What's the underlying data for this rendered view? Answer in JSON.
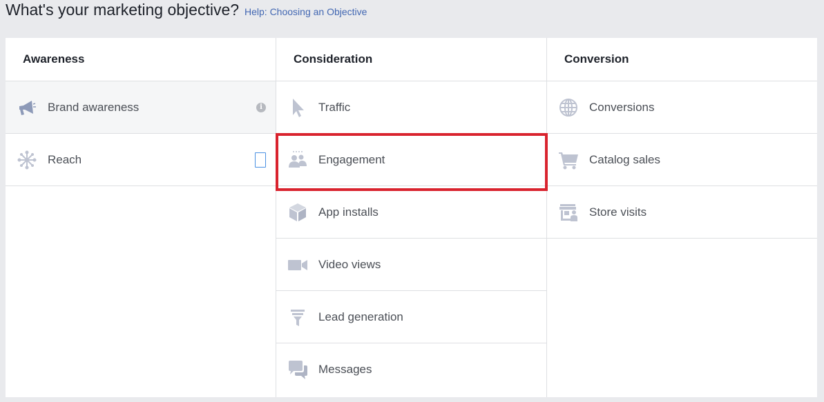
{
  "header": {
    "title": "What's your marketing objective?",
    "help_link": "Help: Choosing an Objective"
  },
  "columns": [
    {
      "heading": "Awareness",
      "items": [
        {
          "label": "Brand awareness",
          "icon": "megaphone-icon",
          "selected": true
        },
        {
          "label": "Reach",
          "icon": "reach-icon"
        }
      ]
    },
    {
      "heading": "Consideration",
      "items": [
        {
          "label": "Traffic",
          "icon": "cursor-icon"
        },
        {
          "label": "Engagement",
          "icon": "people-icon",
          "highlighted": true
        },
        {
          "label": "App installs",
          "icon": "box-icon"
        },
        {
          "label": "Video views",
          "icon": "video-camera-icon"
        },
        {
          "label": "Lead generation",
          "icon": "funnel-icon"
        },
        {
          "label": "Messages",
          "icon": "chat-bubbles-icon"
        }
      ]
    },
    {
      "heading": "Conversion",
      "items": [
        {
          "label": "Conversions",
          "icon": "globe-icon"
        },
        {
          "label": "Catalog sales",
          "icon": "shopping-cart-icon"
        },
        {
          "label": "Store visits",
          "icon": "storefront-icon"
        }
      ]
    }
  ],
  "colors": {
    "icon": "#bec3d1",
    "highlight": "#d9232e",
    "link": "#4267b2"
  }
}
